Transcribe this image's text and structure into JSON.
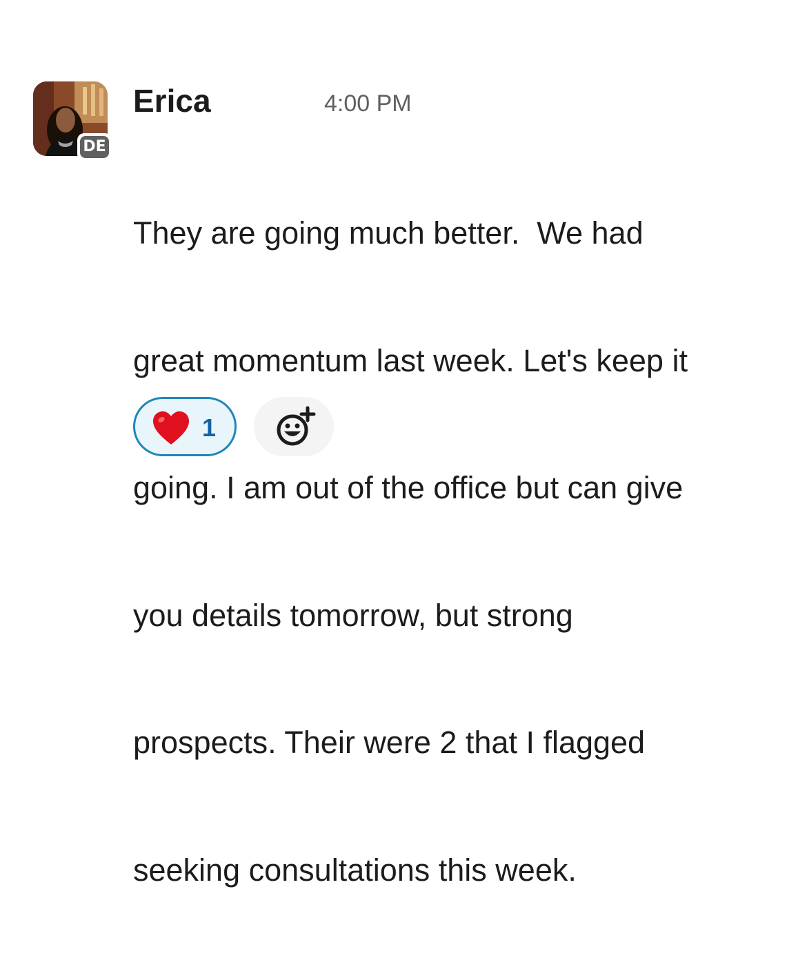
{
  "message": {
    "sender": "Erica",
    "timestamp": "4:00 PM",
    "badge": "DE",
    "lines": [
      "They are going much better.  We had",
      "great momentum last week. Let's keep it",
      "going. I am out of the office but can give",
      "you details tomorrow, but strong",
      "prospects. Their were 2 that I flagged",
      "seeking consultations this week."
    ]
  },
  "reactions": [
    {
      "emoji": "heart-icon",
      "count": "1",
      "selected": true
    }
  ],
  "colors": {
    "reaction_border": "#1d86b8",
    "reaction_bg": "#e8f5fa",
    "reaction_count": "#1264a3",
    "timestamp": "#616061",
    "badge_bg": "#616061"
  }
}
